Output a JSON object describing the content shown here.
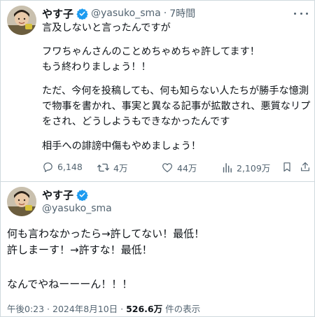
{
  "tweet1": {
    "name": "やす子",
    "handle": "@yasuko_sma",
    "sep": "·",
    "time": "7時間",
    "lines": [
      "言及しないと言ったんですが",
      "フワちゃんさんのことめちゃめちゃ許してます！",
      "もう終わりましょう！！",
      "ただ、今何を投稿しても、何も知らない人たちが勝手な憶測",
      "で物事を書かれ、事実と異なる記事が拡散され、悪質なリプ",
      "をされ、どうしようもできなかったんです",
      "相手への誹謗中傷もやめましょう！"
    ],
    "actions": {
      "reply": "6,148",
      "retweet": "4万",
      "like": "44万",
      "views": "2,109万"
    }
  },
  "tweet2": {
    "name": "やす子",
    "handle": "@yasuko_sma",
    "lines": [
      "何も言わなかったら→許してない！最低！",
      "許しまーす！→許すな！最低！",
      "なんでやねーーーん！！！"
    ],
    "footer": {
      "time": "午後0:23 · 2024年8月10日 · ",
      "views": "526.6万",
      "views_label": " 件の表示"
    }
  },
  "colors": {
    "verified": "#1d9bf0",
    "text": "#0f1419",
    "secondary": "#536471",
    "border": "#cfd9de"
  }
}
